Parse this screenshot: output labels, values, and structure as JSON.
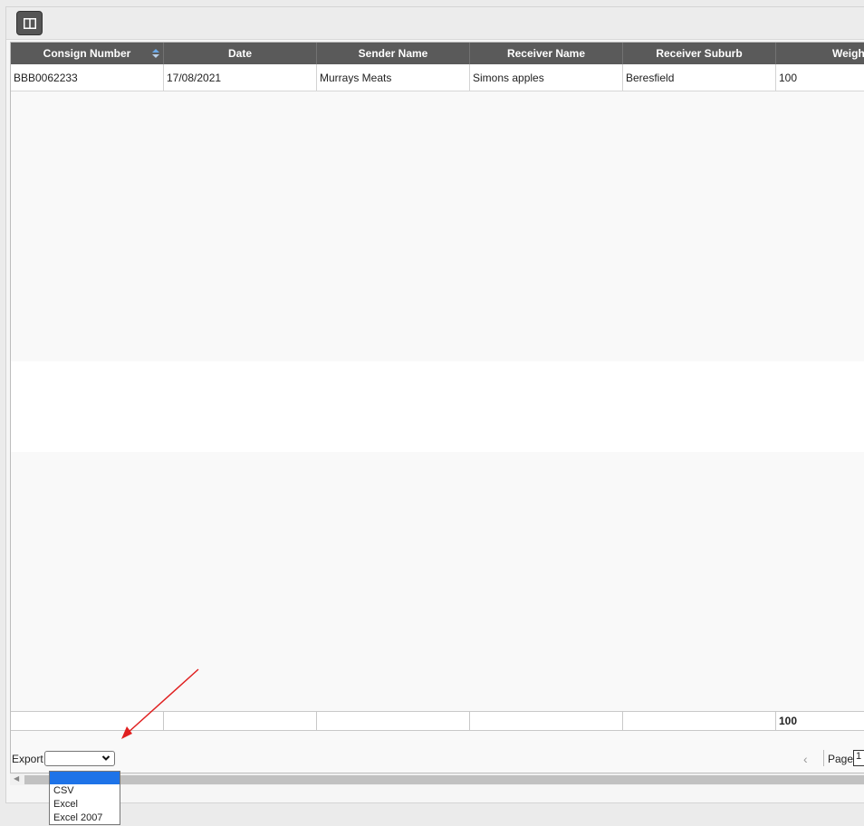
{
  "grid": {
    "columns": [
      "Consign Number",
      "Date",
      "Sender Name",
      "Receiver Name",
      "Receiver Suburb",
      "Weight"
    ],
    "rows": [
      {
        "consign": "BBB0062233",
        "date": "17/08/2021",
        "sender": "Murrays Meats",
        "receiver": "Simons apples",
        "suburb": "Beresfield",
        "weight": "100"
      }
    ],
    "summary": {
      "weight_total": "100"
    }
  },
  "footer": {
    "export_label": "Export",
    "export_selected": "",
    "export_options": [
      "",
      "CSV",
      "Excel",
      "Excel 2007"
    ],
    "page_label": "Page",
    "page_value": "1"
  },
  "colors": {
    "header_bg": "#5a5a5a",
    "selected_option": "#1e73e8",
    "annotation_arrow": "#e02020"
  },
  "icons": {
    "toolbar": "column-chooser-icon",
    "sort": "sort-arrows-icon",
    "prev": "chevron-left-icon"
  }
}
